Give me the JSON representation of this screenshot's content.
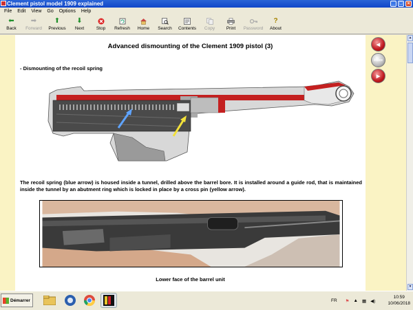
{
  "window": {
    "title": "Clement pistol model 1909 explained",
    "controls": [
      "_",
      "□",
      "×"
    ]
  },
  "menu": [
    "File",
    "Edit",
    "View",
    "Go",
    "Options",
    "Help"
  ],
  "toolbar": [
    {
      "label": "Back",
      "icon": "back-arrow-icon",
      "enabled": true
    },
    {
      "label": "Forward",
      "icon": "forward-arrow-icon",
      "enabled": false
    },
    {
      "label": "Previous",
      "icon": "up-arrow-icon",
      "enabled": true
    },
    {
      "label": "Next",
      "icon": "down-arrow-icon",
      "enabled": true
    },
    {
      "label": "Stop",
      "icon": "stop-icon",
      "enabled": true
    },
    {
      "label": "Refresh",
      "icon": "refresh-icon",
      "enabled": true
    },
    {
      "label": "Home",
      "icon": "home-icon",
      "enabled": true
    },
    {
      "label": "Search",
      "icon": "search-icon",
      "enabled": true
    },
    {
      "label": "Contents",
      "icon": "contents-icon",
      "enabled": true
    },
    {
      "label": "Copy",
      "icon": "copy-icon",
      "enabled": false
    },
    {
      "label": "Print",
      "icon": "print-icon",
      "enabled": true
    },
    {
      "label": "Password",
      "icon": "key-icon",
      "enabled": false
    },
    {
      "label": "About",
      "icon": "question-icon",
      "enabled": true
    }
  ],
  "page": {
    "title": "Advanced dismounting of the Clement 1909 pistol (3)",
    "section": "- Dismounting of the recoil spring",
    "paragraph": "The recoil spring (blue arrow) is housed inside a tunnel, drilled above the barrel bore. It is installed around a guide rod, that is maintained inside the tunnel by an abutment ring which is locked in place by a cross pin (yellow arrow).",
    "caption": "Lower face of the barrel unit"
  },
  "nav": {
    "index_label": "Index"
  },
  "taskbar": {
    "start_label": "Démarrer",
    "language": "FR",
    "time": "10:59",
    "date": "10/06/2018"
  },
  "colors": {
    "accent_red": "#c0181e",
    "page_bg": "#faf3c4",
    "title_bar": "#1046c9"
  }
}
